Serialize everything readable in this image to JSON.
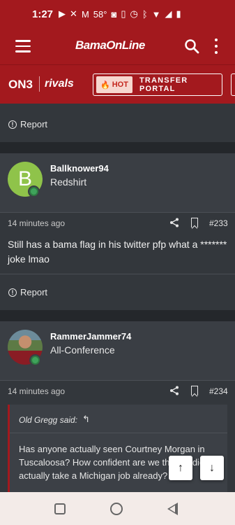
{
  "status_bar": {
    "time": "1:27",
    "temperature": "58°",
    "icons": [
      "youtube-icon",
      "x-icon",
      "gmail-icon",
      "camera-icon",
      "battery-saver-icon",
      "alarm-icon",
      "bluetooth-icon",
      "wifi-icon",
      "signal-icon",
      "battery-icon"
    ]
  },
  "app_bar": {
    "logo": "BamaOnLine"
  },
  "brand_bar": {
    "on3": "ON3",
    "rivals": "rivals",
    "hot_label": "HOT",
    "portal_label": "TRANSFER PORTAL"
  },
  "posts": [
    {
      "report_label": "Report"
    },
    {
      "avatar_letter": "B",
      "username": "Ballknower94",
      "user_title": "Redshirt",
      "time": "14 minutes ago",
      "number": "#233",
      "body": "Still has a bama flag in his twitter pfp what a ******* joke lmao",
      "report_label": "Report"
    },
    {
      "username": "RammerJammer74",
      "user_title": "All-Conference",
      "time": "14 minutes ago",
      "number": "#234",
      "quote_author": "Old Gregg said:",
      "quote_text": "Has anyone actually seen Courtney Morgan in Tuscaloosa? How confident are we that he didn't actually take a Michigan job already?"
    }
  ],
  "scroll_buttons": {
    "up": "↑",
    "down": "↓"
  },
  "colors": {
    "brand_red": "#a3191e",
    "background": "#2b2e33",
    "post_bg": "#33373c",
    "online_green": "#3fa35b"
  }
}
